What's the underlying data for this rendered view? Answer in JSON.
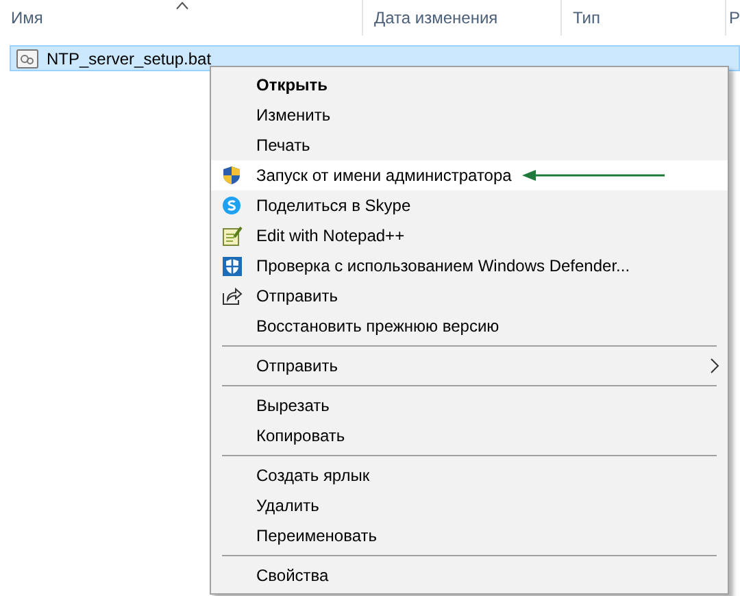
{
  "columns": [
    {
      "label": "Имя",
      "sorted": true
    },
    {
      "label": "Дата изменения"
    },
    {
      "label": "Тип"
    },
    {
      "label": "Р"
    }
  ],
  "file": {
    "name": "NTP_server_setup.bat",
    "selected": true
  },
  "menu": [
    {
      "kind": "plain",
      "label": "Открыть",
      "bold": true,
      "selected": false
    },
    {
      "kind": "plain",
      "label": "Изменить",
      "bold": false,
      "selected": false
    },
    {
      "kind": "plain",
      "label": "Печать",
      "bold": false,
      "selected": false
    },
    {
      "kind": "shield",
      "label": "Запуск от имени администратора",
      "bold": false,
      "selected": true,
      "pointer_arrow": true
    },
    {
      "kind": "skype",
      "label": "Поделиться в Skype",
      "bold": false,
      "selected": false
    },
    {
      "kind": "notepad",
      "label": "Edit with Notepad++",
      "bold": false,
      "selected": false
    },
    {
      "kind": "defender",
      "label": "Проверка с использованием Windows Defender...",
      "bold": false,
      "selected": false
    },
    {
      "kind": "share",
      "label": "Отправить",
      "bold": false,
      "selected": false
    },
    {
      "kind": "plain",
      "label": "Восстановить прежнюю версию",
      "bold": false,
      "selected": false
    },
    {
      "kind": "separator"
    },
    {
      "kind": "plain",
      "label": "Отправить",
      "bold": false,
      "submenu": true,
      "selected": false
    },
    {
      "kind": "separator"
    },
    {
      "kind": "plain",
      "label": "Вырезать",
      "bold": false,
      "selected": false
    },
    {
      "kind": "plain",
      "label": "Копировать",
      "bold": false,
      "selected": false
    },
    {
      "kind": "separator"
    },
    {
      "kind": "plain",
      "label": "Создать ярлык",
      "bold": false,
      "selected": false
    },
    {
      "kind": "plain",
      "label": "Удалить",
      "bold": false,
      "selected": false
    },
    {
      "kind": "plain",
      "label": "Переименовать",
      "bold": false,
      "selected": false
    },
    {
      "kind": "separator"
    },
    {
      "kind": "plain",
      "label": "Свойства",
      "bold": false,
      "selected": false
    }
  ]
}
